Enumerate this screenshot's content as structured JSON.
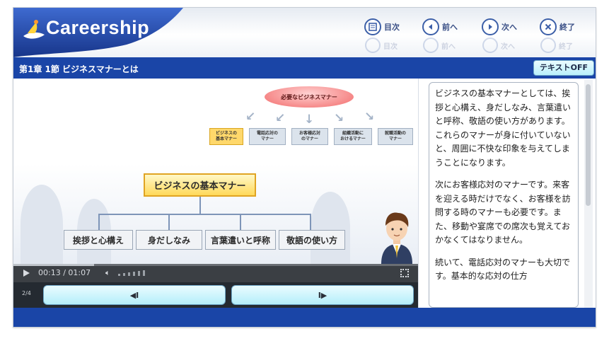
{
  "app": {
    "name": "Careership",
    "colors": {
      "brand": "#1a45a7",
      "accent": "#3c5fa8",
      "highlight": "#ffd95a"
    }
  },
  "nav": {
    "toc_label": "目次",
    "prev_label": "前へ",
    "next_label": "次へ",
    "exit_label": "終了"
  },
  "titlebar": {
    "chapter_title": "第1章 1節 ビジネスマナーとは",
    "text_toggle": "テキストOFF"
  },
  "slide": {
    "bubble": "必要なビジネスマナー",
    "mini_cards": [
      {
        "line1": "ビジネスの",
        "line2": "基本マナー"
      },
      {
        "line1": "電話応対の",
        "line2": "マナー"
      },
      {
        "line1": "お客様応対",
        "line2": "のマナー"
      },
      {
        "line1": "組織活動に",
        "line2": "おけるマナー"
      },
      {
        "line1": "就職活動の",
        "line2": "マナー"
      }
    ],
    "main_box": "ビジネスの基本マナー",
    "leaves": [
      "挨拶と心構え",
      "身だしなみ",
      "言葉遣いと呼称",
      "敬語の使い方"
    ]
  },
  "player": {
    "time_current": "00:13",
    "time_total": "01:07",
    "timecode": "00:13 / 01:07",
    "progress": 0.2
  },
  "pager": {
    "page": "2/4",
    "prev_label": "◀I",
    "next_label": "I▶"
  },
  "transcript": {
    "paragraphs": [
      "ビジネスの基本マナーとしては、挨拶と心構え、身だしなみ、言葉遣いと呼称、敬語の使い方があります。これらのマナーが身に付いていないと、周囲に不快な印象を与えてしまうことになります。",
      "次にお客様応対のマナーです。来客を迎える時だけでなく、お客様を訪問する時のマナーも必要です。また、移動や宴席での席次も覚えておかなくてはなりません。",
      "続いて、電話応対のマナーも大切です。基本的な応対の仕方"
    ]
  }
}
